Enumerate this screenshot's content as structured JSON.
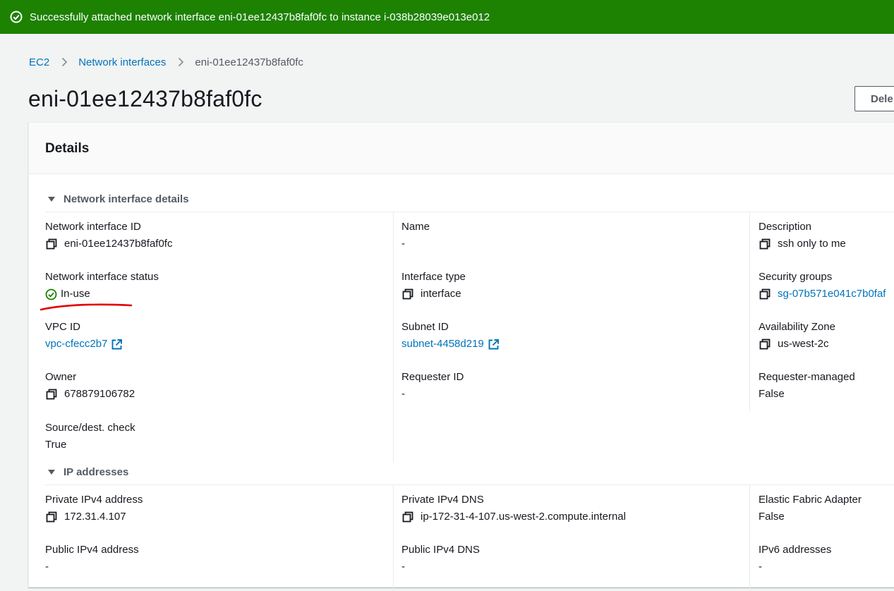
{
  "flash": {
    "message": "Successfully attached network interface eni-01ee12437b8faf0fc to instance i-038b28039e013e012",
    "color": "#1d8102"
  },
  "breadcrumb": {
    "items": [
      "EC2",
      "Network interfaces"
    ],
    "current": "eni-01ee12437b8faf0fc"
  },
  "page": {
    "title": "eni-01ee12437b8faf0fc",
    "delete_label": "Dele"
  },
  "details": {
    "heading": "Details",
    "network_interface_details": {
      "title": "Network interface details",
      "network_interface_id": {
        "label": "Network interface ID",
        "value": "eni-01ee12437b8faf0fc"
      },
      "name": {
        "label": "Name",
        "value": "-"
      },
      "description": {
        "label": "Description",
        "value": "ssh only to me"
      },
      "status": {
        "label": "Network interface status",
        "value": "In-use"
      },
      "interface_type": {
        "label": "Interface type",
        "value": "interface"
      },
      "security_groups": {
        "label": "Security groups",
        "value": "sg-07b571e041c7b0faf"
      },
      "vpc_id": {
        "label": "VPC ID",
        "value": "vpc-cfecc2b7"
      },
      "subnet_id": {
        "label": "Subnet ID",
        "value": "subnet-4458d219"
      },
      "availability_zone": {
        "label": "Availability Zone",
        "value": "us-west-2c"
      },
      "owner": {
        "label": "Owner",
        "value": "678879106782"
      },
      "requester_id": {
        "label": "Requester ID",
        "value": "-"
      },
      "requester_managed": {
        "label": "Requester-managed",
        "value": "False"
      },
      "source_dest_check": {
        "label": "Source/dest. check",
        "value": "True"
      }
    },
    "ip_addresses": {
      "title": "IP addresses",
      "private_ipv4_address": {
        "label": "Private IPv4 address",
        "value": "172.31.4.107"
      },
      "private_ipv4_dns": {
        "label": "Private IPv4 DNS",
        "value": "ip-172-31-4-107.us-west-2.compute.internal"
      },
      "elastic_fabric_adapter": {
        "label": "Elastic Fabric Adapter",
        "value": "False"
      },
      "public_ipv4_address": {
        "label": "Public IPv4 address",
        "value": "-"
      },
      "public_ipv4_dns": {
        "label": "Public IPv4 DNS",
        "value": "-"
      },
      "ipv6_addresses": {
        "label": "IPv6 addresses",
        "value": "-"
      }
    }
  },
  "colors": {
    "link": "#0073bb",
    "success": "#1d8102",
    "annotation": "#e00000"
  }
}
